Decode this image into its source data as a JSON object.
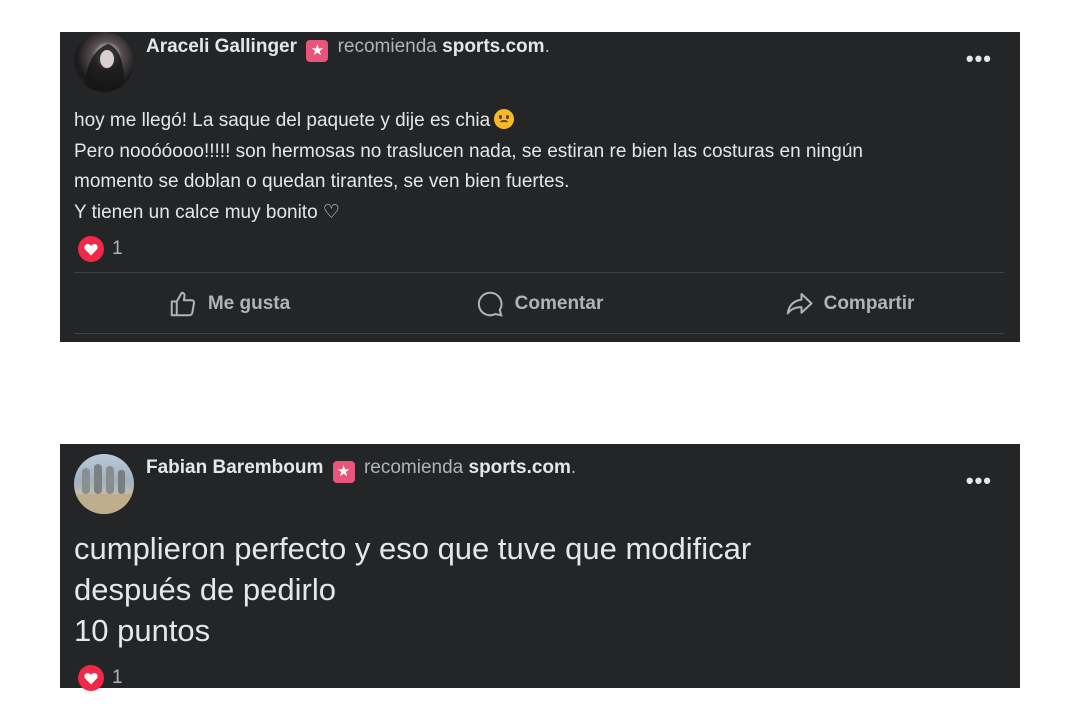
{
  "posts": [
    {
      "author": "Araceli Gallinger",
      "recommend_verb": "recomienda",
      "site": "sports.com",
      "punct": ".",
      "more_label": "•••",
      "body": [
        "hoy me llegó! La saque del paquete y dije es chia",
        "Pero nooóóooo!!!!! son hermosas no traslucen nada, se estiran re bien las costuras en ningún",
        "momento se doblan o quedan tirantes, se ven bien fuertes.",
        "Y tienen un calce muy bonito ♡"
      ],
      "reaction_count": "1",
      "actions": {
        "like": "Me gusta",
        "comment": "Comentar",
        "share": "Compartir"
      }
    },
    {
      "author": "Fabian Baremboum",
      "recommend_verb": "recomienda",
      "site": "sports.com",
      "punct": ".",
      "more_label": "•••",
      "body": [
        "cumplieron perfecto y eso que tuve que modificar",
        "después de pedirlo",
        "10 puntos"
      ],
      "reaction_count": "1"
    }
  ],
  "icons": {
    "badge": "star-badge-icon",
    "reaction": "heart-icon",
    "emoji": "sad-face-emoji",
    "like": "thumbs-up-icon",
    "comment": "comment-bubble-icon",
    "share": "share-arrow-icon"
  },
  "colors": {
    "card_bg": "#242526",
    "text": "#e4e6eb",
    "muted": "#b0b3b8",
    "badge": "#e9557a",
    "heart": "#f02849"
  }
}
